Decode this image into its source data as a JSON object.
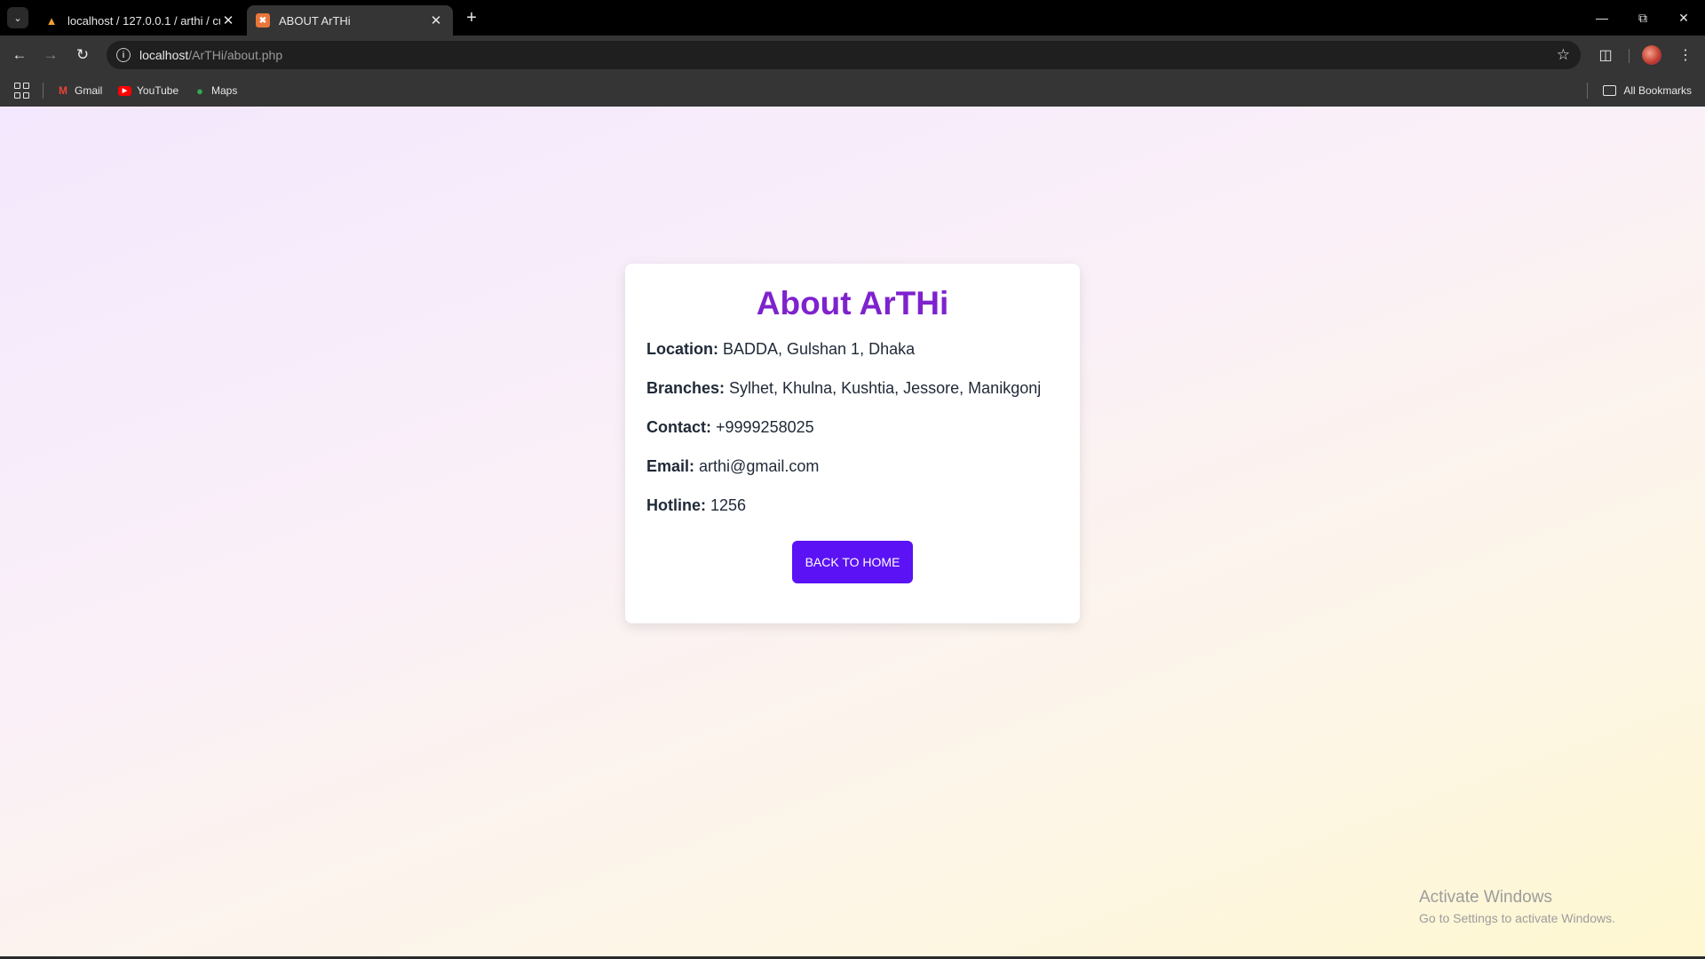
{
  "browser": {
    "tabs": [
      {
        "title": "localhost / 127.0.0.1 / arthi / cu",
        "favicon": "phpmyadmin-icon"
      },
      {
        "title": "ABOUT ArTHi",
        "favicon": "xampp-icon"
      }
    ],
    "url_host": "localhost",
    "url_path": "/ArTHi/about.php",
    "bookmarks": [
      "Gmail",
      "YouTube",
      "Maps"
    ],
    "all_bookmarks": "All Bookmarks"
  },
  "about": {
    "title": "About ArTHi",
    "rows": [
      {
        "label": "Location:",
        "value": "BADDA, Gulshan 1, Dhaka"
      },
      {
        "label": "Branches:",
        "value": "Sylhet, Khulna, Kushtia, Jessore, Manikgonj"
      },
      {
        "label": "Contact:",
        "value": "+9999258025"
      },
      {
        "label": "Email:",
        "value": "arthi@gmail.com"
      },
      {
        "label": "Hotline:",
        "value": "1256"
      }
    ],
    "button_label": "BACK TO HOME"
  },
  "watermark": {
    "title": "Activate Windows",
    "subtitle": "Go to Settings to activate Windows."
  },
  "colors": {
    "title": "#7e22ce",
    "button": "#5b12f5"
  }
}
